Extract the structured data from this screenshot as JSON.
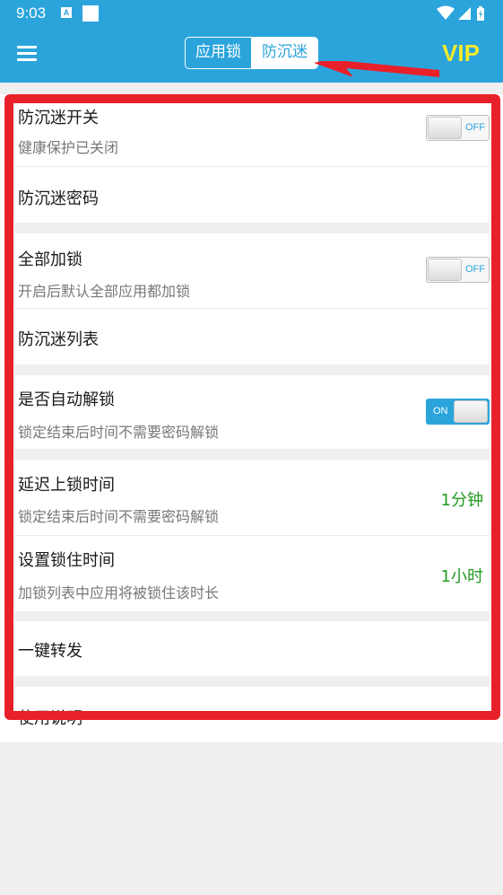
{
  "status_bar": {
    "time": "9:03",
    "notif_a": "A"
  },
  "app_bar": {
    "tabs": [
      {
        "label": "应用锁"
      },
      {
        "label": "防沉迷"
      }
    ],
    "vip_label": "VIP"
  },
  "settings": {
    "anti_addiction": {
      "title": "防沉迷开关",
      "subtitle": "健康保护已关闭",
      "toggle": "OFF"
    },
    "anti_addiction_password": {
      "title": "防沉迷密码"
    },
    "lock_all": {
      "title": "全部加锁",
      "subtitle": "开启后默认全部应用都加锁",
      "toggle": "OFF"
    },
    "anti_addiction_list": {
      "title": "防沉迷列表"
    },
    "auto_unlock": {
      "title": "是否自动解锁",
      "subtitle": "锁定结束后时间不需要密码解锁",
      "toggle": "ON"
    },
    "delay_lock": {
      "title": "延迟上锁时间",
      "subtitle": "锁定结束后时间不需要密码解锁",
      "value": "1分钟"
    },
    "lock_duration": {
      "title": "设置锁住时间",
      "subtitle": "加锁列表中应用将被锁住该时长",
      "value": "1小时"
    },
    "one_key_forward": {
      "title": "一键转发"
    },
    "usage_instructions": {
      "title": "使用说明"
    }
  },
  "colors": {
    "primary": "#2ba4dc",
    "vip": "#f3ea2c",
    "annotation": "#e8202a",
    "value_text": "#1f9a1f"
  }
}
